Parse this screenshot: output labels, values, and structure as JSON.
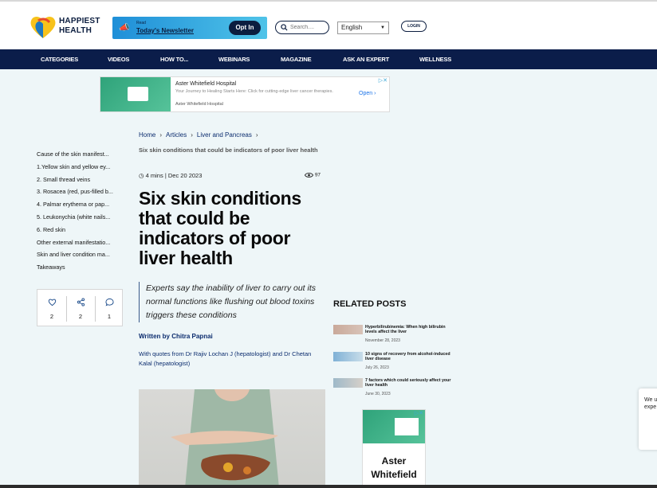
{
  "header": {
    "logo_line1": "HAPPIEST",
    "logo_line2": "HEALTH",
    "newsletter_small": "Read",
    "newsletter_title": "Today's Newsletter",
    "newsletter_button": "Opt In",
    "search_placeholder": "Search....",
    "language": "English",
    "login": "LOGIN"
  },
  "nav": {
    "items": [
      {
        "label": "CATEGORIES"
      },
      {
        "label": "VIDEOS"
      },
      {
        "label": "HOW TO..."
      },
      {
        "label": "WEBINARS"
      },
      {
        "label": "MAGAZINE"
      },
      {
        "label": "ASK AN EXPERT"
      },
      {
        "label": "WELLNESS"
      }
    ]
  },
  "ad_banner": {
    "title": "Aster Whitefield Hospital",
    "description": "Your Journey to Healing Starts Here: Click for cutting-edge liver cancer therapies.",
    "sub": "Aster Whitefield Hospital",
    "cta": "Open"
  },
  "toc": {
    "items": [
      "Cause of the skin manifest...",
      "1.Yellow skin and yellow ey...",
      "2. Small thread veins",
      "3. Rosacea (red, pus-filled b...",
      "4. Palmar erythema or pap...",
      "5. Leukonychia (white nails...",
      "6. Red skin",
      "Other external manifestatio...",
      "Skin and liver condition ma...",
      "Takeaways"
    ]
  },
  "share": {
    "likes": "2",
    "shares": "2",
    "comments": "1"
  },
  "article": {
    "breadcrumb": [
      "Home",
      "Articles",
      "Liver and Pancreas"
    ],
    "breadcrumb_sub": "Six skin conditions that could be indicators of poor liver health",
    "read_time": "4 mins",
    "date": "Dec 20 2023",
    "views": "97",
    "headline": "Six skin conditions that could be indicators of poor liver health",
    "summary": "Experts say the inability of liver to carry out its normal functions like flushing out blood toxins triggers these conditions",
    "author": "Written by Chitra Papnai",
    "quotes_with": "With quotes from Dr Rajiv Lochan J (hepatologist) and Dr Chetan Kalal (hepatologist)"
  },
  "related": {
    "title": "RELATED POSTS",
    "posts": [
      {
        "title": "Hyperbilirubinemia: When high bilirubin levels affect the liver",
        "date": "November 28, 2023"
      },
      {
        "title": "10 signs of recovery from alcohol-induced liver disease",
        "date": "July 26, 2023"
      },
      {
        "title": "7 factors which could seriously affect your liver health",
        "date": "June 30, 2023"
      }
    ]
  },
  "ad_side": {
    "text": "Aster Whitefield"
  },
  "cookie": {
    "text": "We u expe"
  }
}
